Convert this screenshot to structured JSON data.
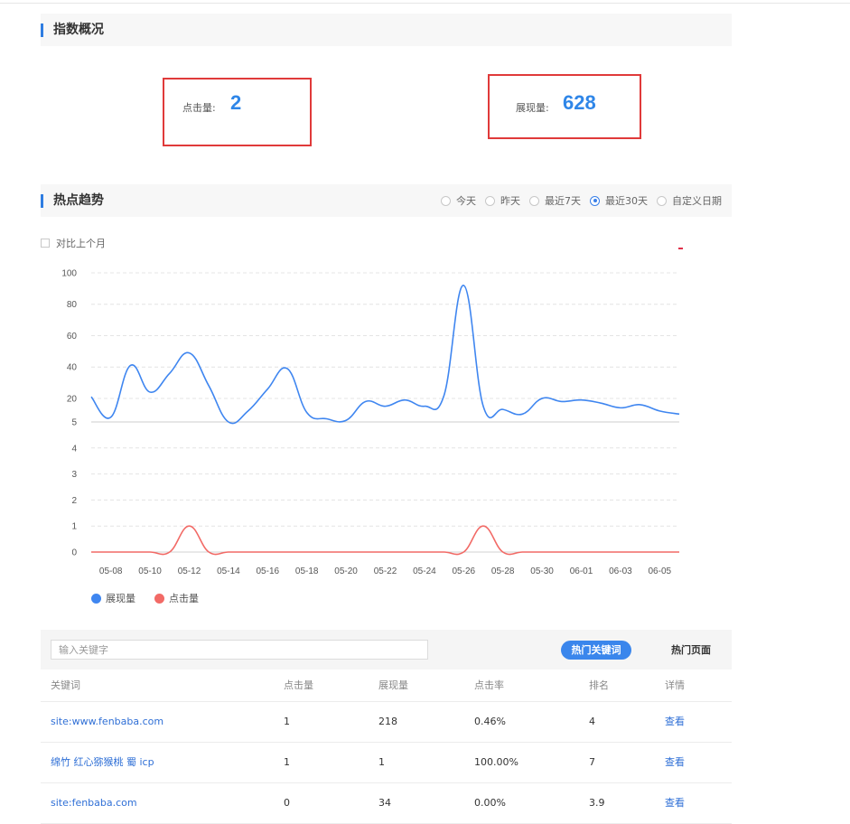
{
  "overview": {
    "title": "指数概况",
    "clicks_label": "点击量:",
    "clicks_value": "2",
    "impressions_label": "展现量:",
    "impressions_value": "628"
  },
  "trend": {
    "title": "热点趋势",
    "ranges": [
      {
        "label": "今天",
        "checked": false
      },
      {
        "label": "昨天",
        "checked": false
      },
      {
        "label": "最近7天",
        "checked": false
      },
      {
        "label": "最近30天",
        "checked": true
      },
      {
        "label": "自定义日期",
        "checked": false
      }
    ],
    "compare_label": "对比上个月"
  },
  "chart_data": {
    "type": "line",
    "x": [
      "05-07",
      "05-08",
      "05-09",
      "05-10",
      "05-11",
      "05-12",
      "05-13",
      "05-14",
      "05-15",
      "05-16",
      "05-17",
      "05-18",
      "05-19",
      "05-20",
      "05-21",
      "05-22",
      "05-23",
      "05-24",
      "05-25",
      "05-26",
      "05-27",
      "05-28",
      "05-29",
      "05-30",
      "05-31",
      "06-01",
      "06-02",
      "06-03",
      "06-04",
      "06-05",
      "06-06"
    ],
    "x_tick_labels": [
      "05-08",
      "05-10",
      "05-12",
      "05-14",
      "05-16",
      "05-18",
      "05-20",
      "05-22",
      "05-24",
      "05-26",
      "05-28",
      "05-30",
      "06-01",
      "06-03",
      "06-05"
    ],
    "upper_axis": {
      "range": [
        5,
        100
      ],
      "ticks": [
        5,
        20,
        40,
        60,
        80,
        100
      ]
    },
    "lower_axis": {
      "range": [
        0,
        5
      ],
      "ticks": [
        0,
        1,
        2,
        3,
        4,
        5
      ]
    },
    "series": [
      {
        "name": "展现量",
        "color": "#3f86f0",
        "axis": "upper",
        "values": [
          21,
          8,
          41,
          24,
          36,
          49,
          28,
          5,
          12,
          26,
          39,
          11,
          7,
          6,
          18,
          15,
          19,
          15,
          22,
          92,
          15,
          13,
          10,
          20,
          18,
          19,
          17,
          14,
          16,
          12,
          10
        ]
      },
      {
        "name": "点击量",
        "color": "#f26a66",
        "axis": "lower",
        "values": [
          0,
          0,
          0,
          0,
          0,
          1,
          0,
          0,
          0,
          0,
          0,
          0,
          0,
          0,
          0,
          0,
          0,
          0,
          0,
          0,
          1,
          0,
          0,
          0,
          0,
          0,
          0,
          0,
          0,
          0,
          0
        ]
      }
    ],
    "grid": true,
    "legend_position": "bottom-left"
  },
  "keywords": {
    "search_placeholder": "输入关键字",
    "tab_hot_keywords": "热门关键词",
    "tab_hot_pages": "热门页面",
    "columns": [
      "关键词",
      "点击量",
      "展现量",
      "点击率",
      "排名",
      "详情"
    ],
    "rows": [
      {
        "keyword": "site:www.fenbaba.com",
        "clicks": "1",
        "impressions": "218",
        "ctr": "0.46%",
        "rank": "4",
        "detail": "查看"
      },
      {
        "keyword": "绵竹 红心猕猴桃 蜀 icp",
        "clicks": "1",
        "impressions": "1",
        "ctr": "100.00%",
        "rank": "7",
        "detail": "查看"
      },
      {
        "keyword": "site:fenbaba.com",
        "clicks": "0",
        "impressions": "34",
        "ctr": "0.00%",
        "rank": "3.9",
        "detail": "查看"
      }
    ]
  }
}
